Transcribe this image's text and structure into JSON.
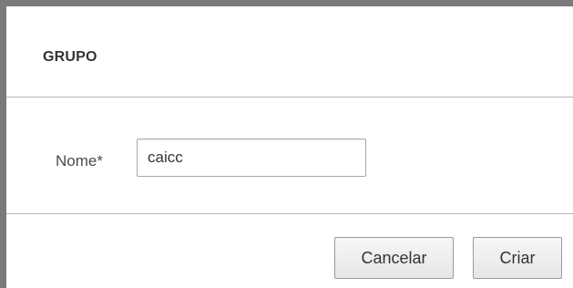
{
  "dialog": {
    "title": "GRUPO"
  },
  "form": {
    "name_label": "Nome*",
    "name_value": "caicc"
  },
  "footer": {
    "cancel_label": "Cancelar",
    "create_label": "Criar"
  }
}
